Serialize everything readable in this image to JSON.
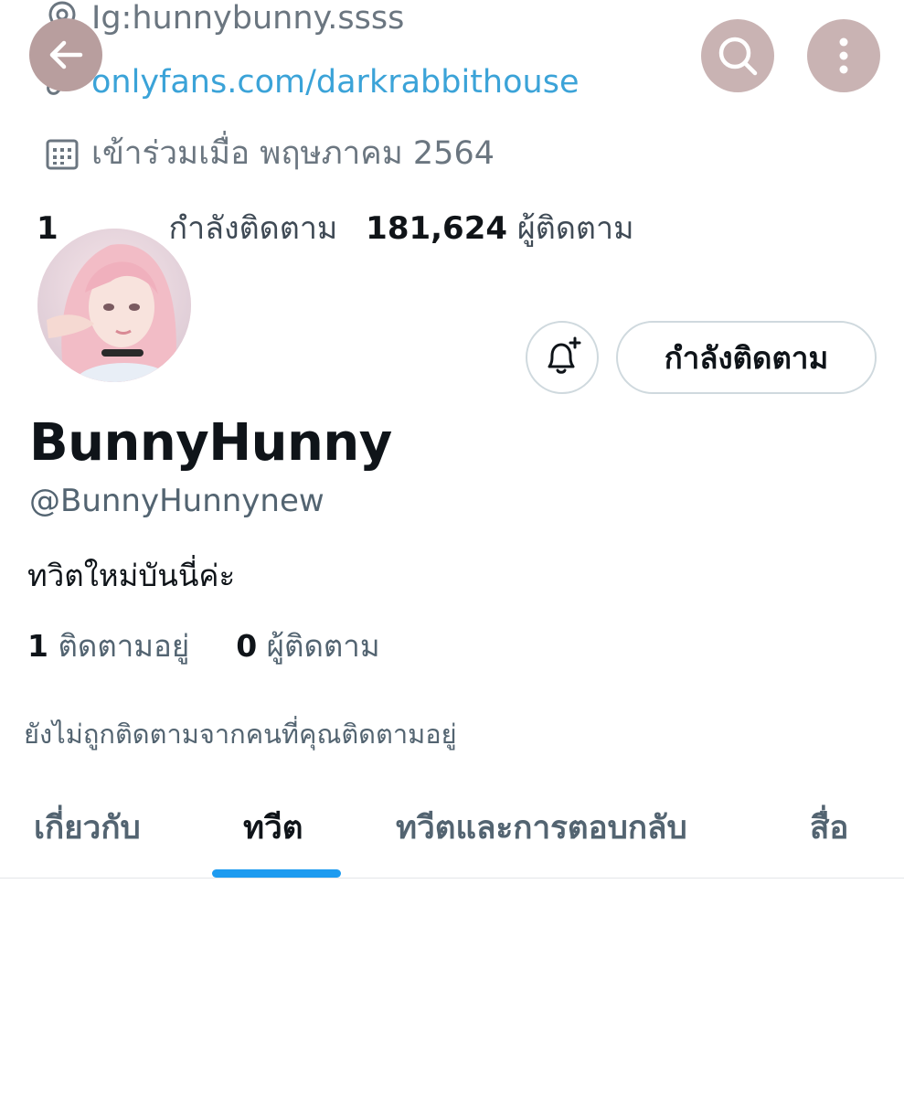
{
  "background_profile": {
    "location_text": "Ig:hunnybunny.ssss",
    "link_text": "onlyfans.com/darkrabbithouse",
    "joined_text": "เข้าร่วมเมื่อ พฤษภาคม 2564",
    "following_fragment": "1",
    "following_label_partial": "กำลังติดตาม",
    "followers_count": "181,624",
    "followers_label": "ผู้ติดตาม"
  },
  "header": {
    "back_icon": "arrow-left-icon",
    "search_icon": "search-icon",
    "more_icon": "more-vertical-icon"
  },
  "profile": {
    "display_name": "BunnyHunny",
    "handle": "@BunnyHunnynew",
    "bio": "ทวิตใหม่บันนี่ค่ะ",
    "following_count": "1",
    "following_label": "ติดตามอยู่",
    "followers_count": "0",
    "followers_label": "ผู้ติดตาม",
    "not_followed_notice": "ยังไม่ถูกติดตามจากคนที่คุณติดตามอยู่"
  },
  "actions": {
    "notify_icon": "bell-plus-icon",
    "follow_label": "กำลังติดตาม"
  },
  "tabs": [
    {
      "label": "เกี่ยวกับ"
    },
    {
      "label": "ทวีต"
    },
    {
      "label": "ทวีตและการตอบกลับ"
    },
    {
      "label": "สื่อ"
    }
  ],
  "active_tab": "ทวีต",
  "colors": {
    "accent": "#1d9bf0",
    "secondary_text": "#536471",
    "overlay_button": "#c9b3b3"
  }
}
